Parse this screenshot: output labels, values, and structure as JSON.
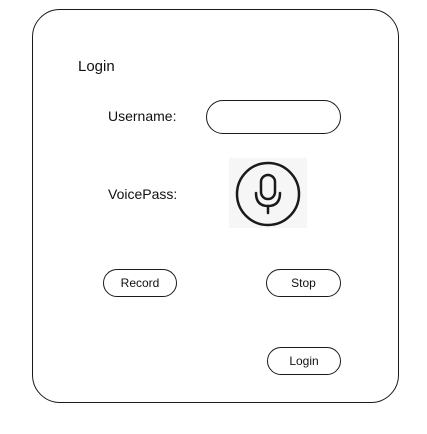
{
  "form": {
    "title": "Login",
    "username_label": "Username:",
    "username_value": "",
    "voicepass_label": "VoicePass:",
    "mic_icon": "microphone-icon"
  },
  "buttons": {
    "record_label": "Record",
    "stop_label": "Stop",
    "login_label": "Login"
  }
}
